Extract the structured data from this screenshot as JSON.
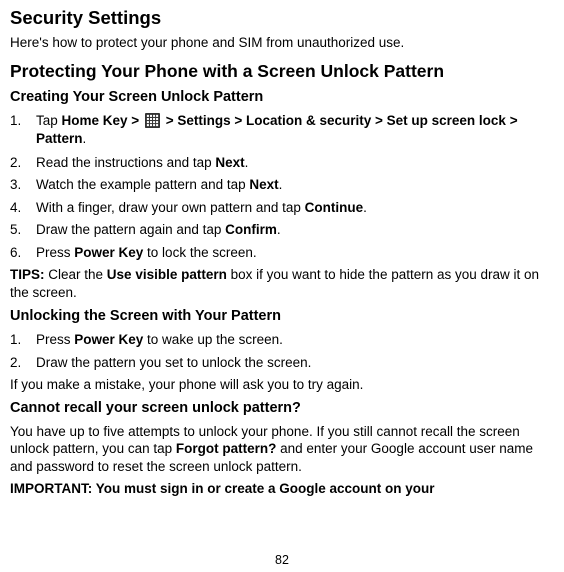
{
  "title": "Security Settings",
  "intro": "Here's how to protect your phone and SIM from unauthorized use.",
  "section1": {
    "heading": "Protecting Your Phone with a Screen Unlock Pattern",
    "sub1": {
      "heading": "Creating Your Screen Unlock Pattern",
      "step1_a": "Tap ",
      "step1_b": "Home Key > ",
      "step1_c": " > Settings > Location & security > Set up screen lock > Pattern",
      "step1_d": ".",
      "step2_a": "Read the instructions and tap ",
      "step2_b": "Next",
      "step2_c": ".",
      "step3_a": "Watch the example pattern and tap ",
      "step3_b": "Next",
      "step3_c": ".",
      "step4_a": "With a finger, draw your own pattern and tap ",
      "step4_b": "Continue",
      "step4_c": ".",
      "step5_a": "Draw the pattern again and tap ",
      "step5_b": "Confirm",
      "step5_c": ".",
      "step6_a": "Press ",
      "step6_b": "Power Key",
      "step6_c": " to lock the screen.",
      "tips_label": "TIPS:",
      "tips_a": " Clear the ",
      "tips_b": "Use visible pattern",
      "tips_c": " box if you want to hide the pattern as you draw it on the screen."
    },
    "sub2": {
      "heading": "Unlocking the Screen with Your Pattern",
      "step1_a": "Press ",
      "step1_b": "Power Key",
      "step1_c": " to wake up the screen.",
      "step2": "Draw the pattern you set to unlock the screen.",
      "after": "If you make a mistake, your phone will ask you to try again."
    },
    "sub3": {
      "heading": "Cannot recall your screen unlock pattern?",
      "p1_a": "You have up to five attempts to unlock your phone. If you still cannot recall the screen unlock pattern, you can tap ",
      "p1_b": "Forgot pattern?",
      "p1_c": " and enter your Google account user name and password to reset the screen unlock pattern.",
      "important": "IMPORTANT: You must sign in or create a Google account on your"
    }
  },
  "page_number": "82"
}
